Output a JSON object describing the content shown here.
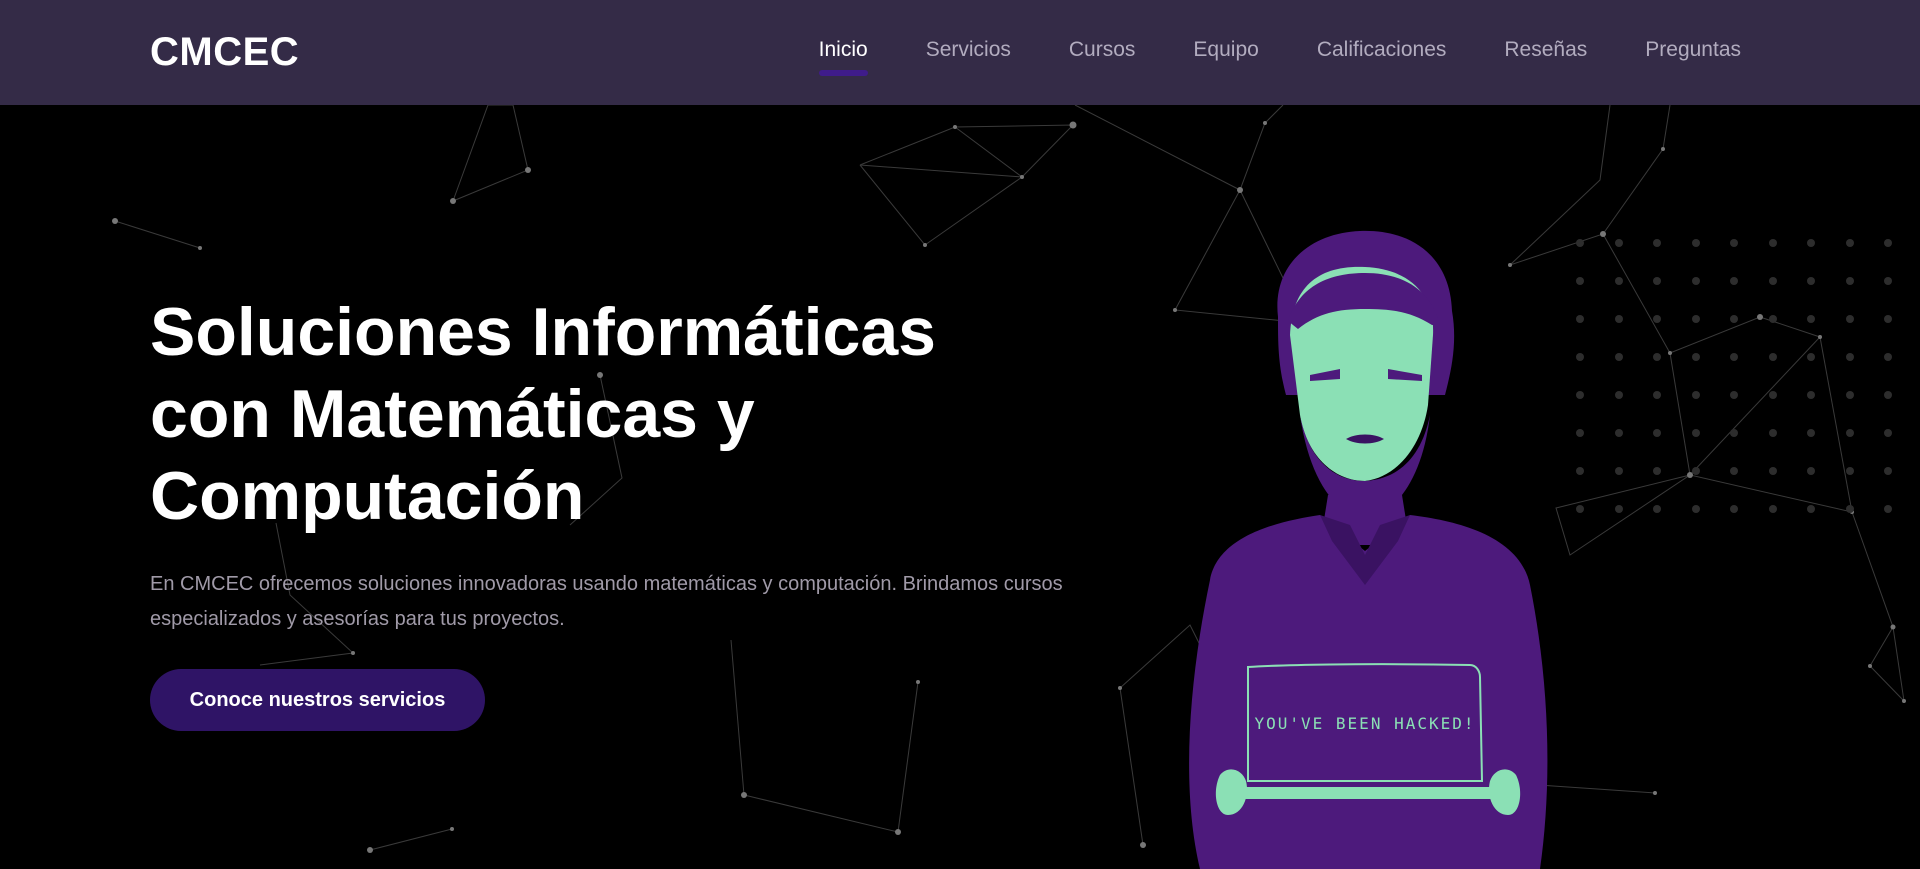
{
  "brand": "CMCEC",
  "nav": {
    "items": [
      {
        "label": "Inicio",
        "active": true
      },
      {
        "label": "Servicios",
        "active": false
      },
      {
        "label": "Cursos",
        "active": false
      },
      {
        "label": "Equipo",
        "active": false
      },
      {
        "label": "Calificaciones",
        "active": false
      },
      {
        "label": "Reseñas",
        "active": false
      },
      {
        "label": "Preguntas",
        "active": false
      }
    ]
  },
  "hero": {
    "title_line1": "Soluciones Informáticas",
    "title_line2": "con Matemáticas y",
    "title_line3": "Computación",
    "description": "En CMCEC ofrecemos soluciones innovadoras usando matemáticas y computación. Brindamos cursos especializados y asesorías para tus proyectos.",
    "cta_label": "Conoce nuestros servicios",
    "laptop_screen_text": "YOU'VE BEEN HACKED!"
  },
  "colors": {
    "navbar_bg": "#342b47",
    "accent": "#2f1466",
    "person_purple": "#4d1a7c",
    "person_face": "#8be0b5"
  }
}
